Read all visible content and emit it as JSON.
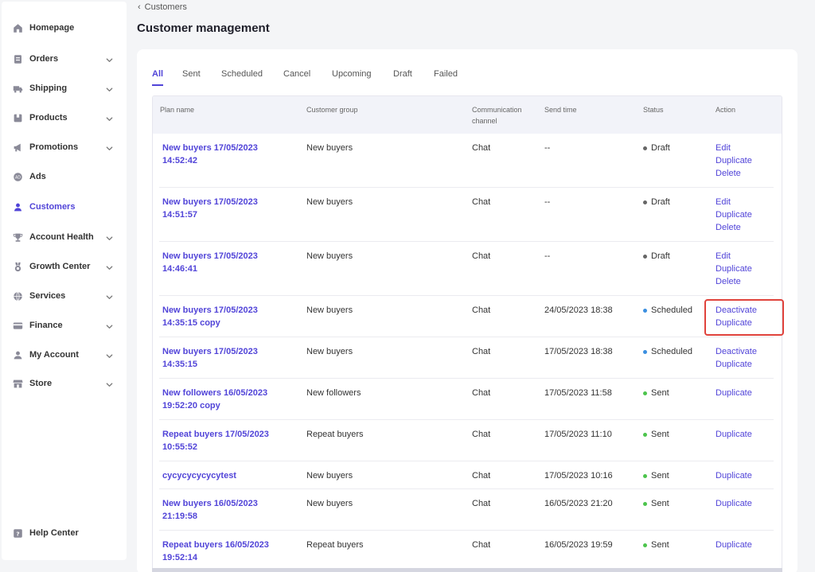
{
  "sidebar": {
    "items": [
      {
        "label": "Homepage",
        "icon": "home-icon",
        "chevron": false,
        "active": false
      },
      {
        "label": "Orders",
        "icon": "orders-icon",
        "chevron": true,
        "active": false
      },
      {
        "label": "Shipping",
        "icon": "truck-icon",
        "chevron": true,
        "active": false
      },
      {
        "label": "Products",
        "icon": "box-icon",
        "chevron": true,
        "active": false
      },
      {
        "label": "Promotions",
        "icon": "megaphone-icon",
        "chevron": true,
        "active": false
      },
      {
        "label": "Ads",
        "icon": "ads-icon",
        "chevron": false,
        "active": false
      },
      {
        "label": "Customers",
        "icon": "person-icon",
        "chevron": false,
        "active": true
      },
      {
        "label": "Account Health",
        "icon": "trophy-icon",
        "chevron": true,
        "active": false
      },
      {
        "label": "Growth Center",
        "icon": "medal-icon",
        "chevron": true,
        "active": false
      },
      {
        "label": "Services",
        "icon": "globe-icon",
        "chevron": true,
        "active": false
      },
      {
        "label": "Finance",
        "icon": "card-icon",
        "chevron": true,
        "active": false
      },
      {
        "label": "My Account",
        "icon": "user-icon",
        "chevron": true,
        "active": false
      },
      {
        "label": "Store",
        "icon": "store-icon",
        "chevron": true,
        "active": false
      }
    ],
    "help": {
      "label": "Help Center",
      "icon": "help-icon"
    }
  },
  "header": {
    "breadcrumb": "Customers",
    "title": "Customer management"
  },
  "tabs": [
    "All",
    "Sent",
    "Scheduled",
    "Cancel",
    "Upcoming",
    "Draft",
    "Failed"
  ],
  "active_tab": "All",
  "table": {
    "headers": {
      "plan_name": "Plan name",
      "customer_group": "Customer group",
      "channel_line1": "Communication",
      "channel_line2": "channel",
      "send_time": "Send time",
      "status": "Status",
      "action": "Action"
    },
    "rows": [
      {
        "plan_line1": "New buyers 17/05/2023",
        "plan_line2": "14:52:42",
        "group": "New buyers",
        "channel": "Chat",
        "send_time": "--",
        "status": "Draft",
        "status_color": "#666666",
        "actions": [
          "Edit",
          "Duplicate",
          "Delete"
        ]
      },
      {
        "plan_line1": "New buyers 17/05/2023",
        "plan_line2": "14:51:57",
        "group": "New buyers",
        "channel": "Chat",
        "send_time": "--",
        "status": "Draft",
        "status_color": "#666666",
        "actions": [
          "Edit",
          "Duplicate",
          "Delete"
        ]
      },
      {
        "plan_line1": "New buyers 17/05/2023",
        "plan_line2": "14:46:41",
        "group": "New buyers",
        "channel": "Chat",
        "send_time": "--",
        "status": "Draft",
        "status_color": "#666666",
        "actions": [
          "Edit",
          "Duplicate",
          "Delete"
        ]
      },
      {
        "plan_line1": "New buyers 17/05/2023",
        "plan_line2": "14:35:15 copy",
        "group": "New buyers",
        "channel": "Chat",
        "send_time": "24/05/2023 18:38",
        "status": "Scheduled",
        "status_color": "#3b8fe0",
        "actions": [
          "Deactivate",
          "Duplicate"
        ]
      },
      {
        "plan_line1": "New buyers 17/05/2023",
        "plan_line2": "14:35:15",
        "group": "New buyers",
        "channel": "Chat",
        "send_time": "17/05/2023 18:38",
        "status": "Scheduled",
        "status_color": "#3b8fe0",
        "actions": [
          "Deactivate",
          "Duplicate"
        ]
      },
      {
        "plan_line1": "New followers 16/05/2023",
        "plan_line2": "19:52:20 copy",
        "group": "New followers",
        "channel": "Chat",
        "send_time": "17/05/2023 11:58",
        "status": "Sent",
        "status_color": "#4cc44c",
        "actions": [
          "Duplicate"
        ]
      },
      {
        "plan_line1": "Repeat buyers 17/05/2023",
        "plan_line2": "10:55:52",
        "group": "Repeat buyers",
        "channel": "Chat",
        "send_time": "17/05/2023 11:10",
        "status": "Sent",
        "status_color": "#4cc44c",
        "actions": [
          "Duplicate"
        ]
      },
      {
        "plan_line1": "cycycycycycytest",
        "plan_line2": "",
        "group": "New buyers",
        "channel": "Chat",
        "send_time": "17/05/2023 10:16",
        "status": "Sent",
        "status_color": "#4cc44c",
        "actions": [
          "Duplicate"
        ]
      },
      {
        "plan_line1": "New buyers 16/05/2023",
        "plan_line2": "21:19:58",
        "group": "New buyers",
        "channel": "Chat",
        "send_time": "16/05/2023 21:20",
        "status": "Sent",
        "status_color": "#4cc44c",
        "actions": [
          "Duplicate"
        ]
      },
      {
        "plan_line1": "Repeat buyers 16/05/2023",
        "plan_line2": "19:52:14",
        "group": "Repeat buyers",
        "channel": "Chat",
        "send_time": "16/05/2023 19:59",
        "status": "Sent",
        "status_color": "#4cc44c",
        "actions": [
          "Duplicate"
        ]
      }
    ]
  },
  "colors": {
    "accent": "#5144d8",
    "highlight": "#e0433c",
    "draft": "#666666",
    "scheduled": "#3b8fe0",
    "sent": "#4cc44c"
  }
}
